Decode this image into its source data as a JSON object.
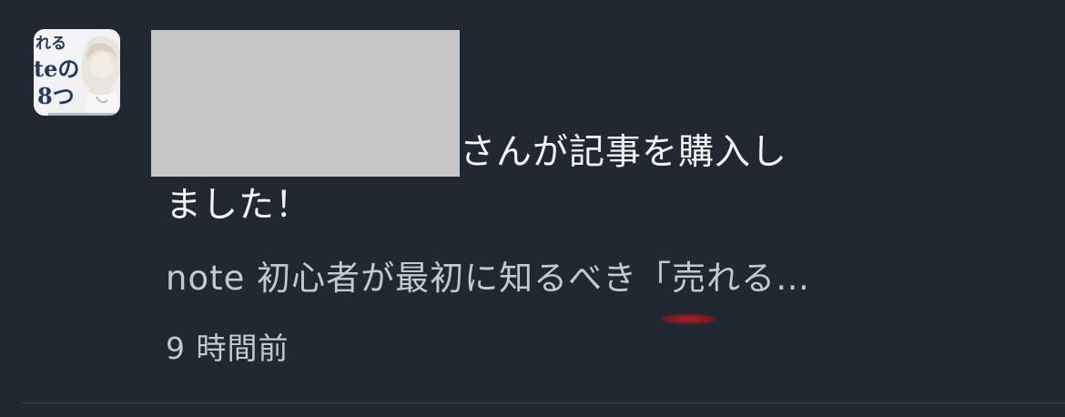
{
  "notification": {
    "message_line1": "さんが記事を購入し",
    "message_line2": "ました！",
    "article_title": "note 初心者が最初に知るべき「売れる…",
    "time_ago": "9 時間前"
  },
  "thumbnail": {
    "line1": "れる",
    "line2": "teの",
    "line3": "8つ"
  },
  "colors": {
    "background": "#212832",
    "text_primary": "#f3f4f6",
    "text_secondary": "#c4c9d0",
    "redaction": "#c6c6c6",
    "title_navy": "#243a5e"
  }
}
